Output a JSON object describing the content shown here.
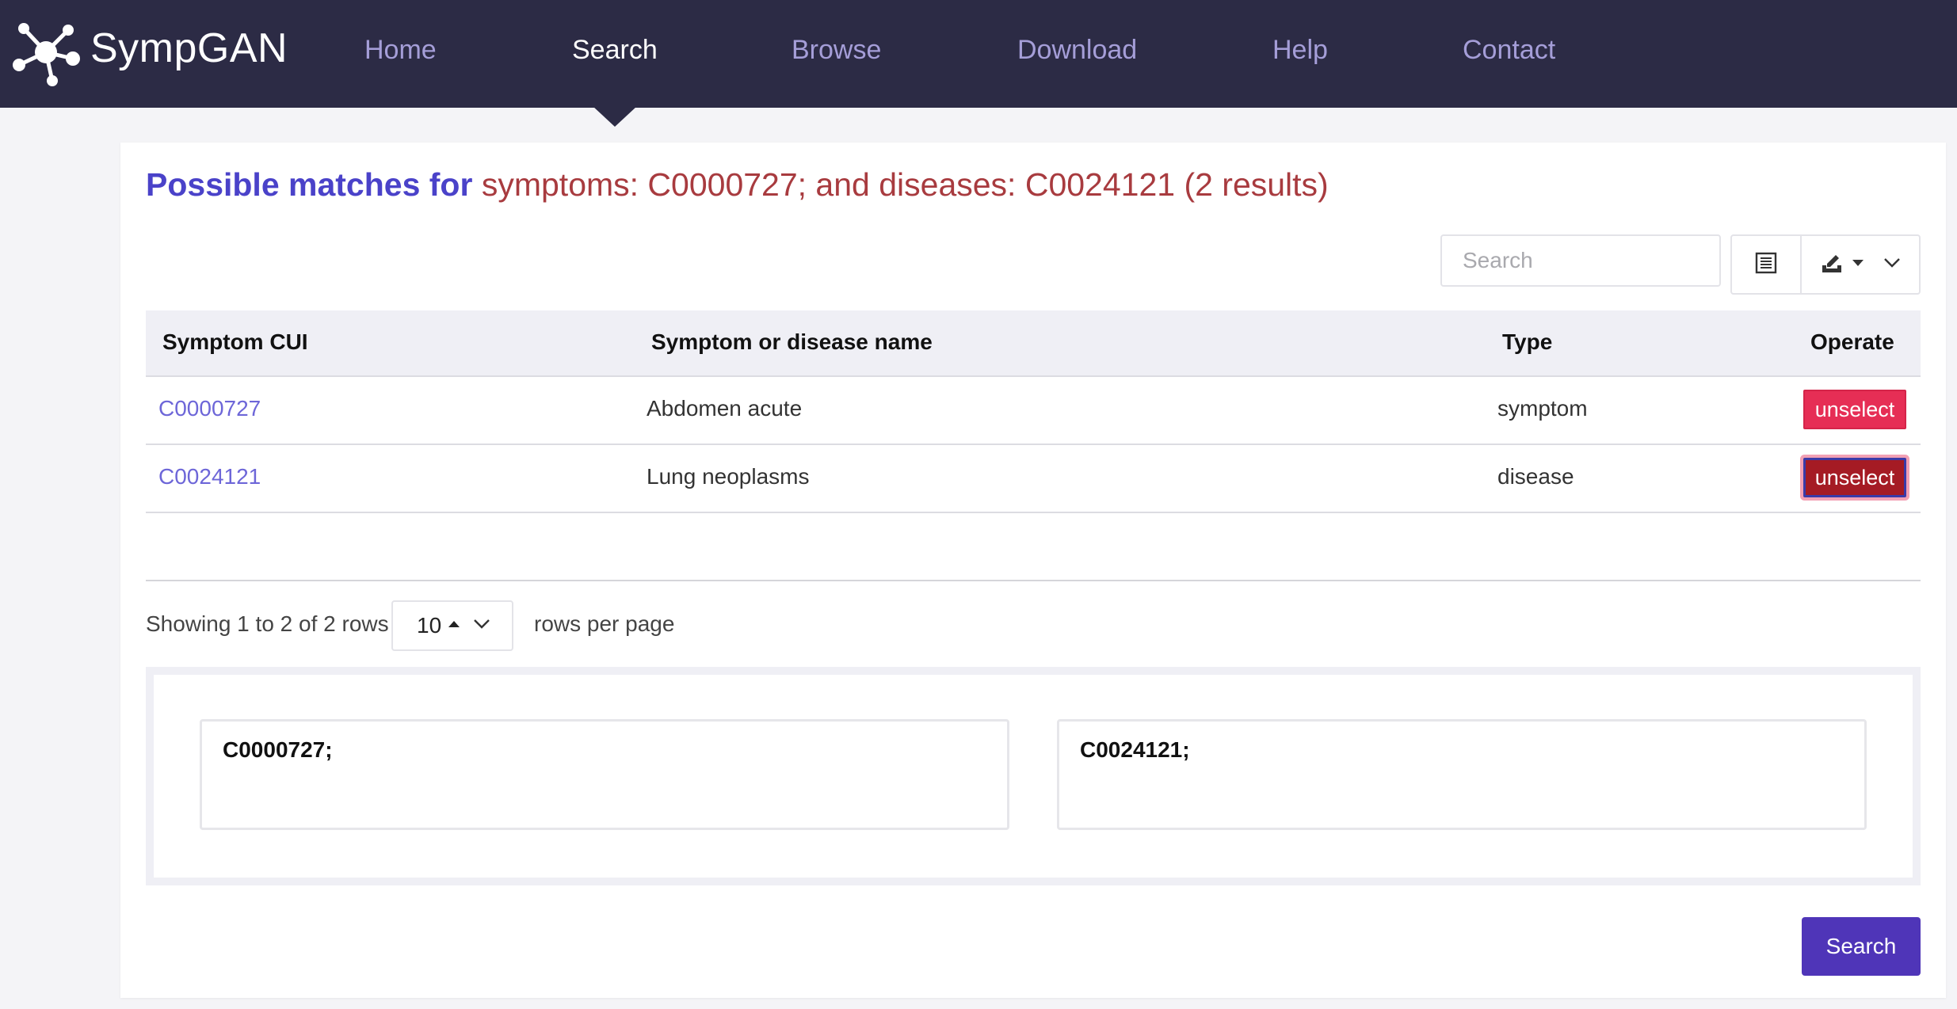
{
  "brand": {
    "name": "SympGAN",
    "logo_icon": "network-nodes-icon"
  },
  "nav": {
    "items": [
      "Home",
      "Search",
      "Browse",
      "Download",
      "Help",
      "Contact"
    ],
    "active": "Search"
  },
  "page": {
    "heading_lead": "Possible matches for",
    "heading_query": "symptoms: C0000727; and diseases: C0024121 (2 results)"
  },
  "toolbar": {
    "search_placeholder": "Search",
    "columns_icon": "list-columns-icon",
    "export_icon": "export-download-icon"
  },
  "table": {
    "headers": [
      "Symptom CUI",
      "Symptom or disease name",
      "Type",
      "Operate"
    ],
    "rows": [
      {
        "cui": "C0000727",
        "name": "Abdomen acute",
        "type": "symptom",
        "action": "unselect"
      },
      {
        "cui": "C0024121",
        "name": "Lung neoplasms",
        "type": "disease",
        "action": "unselect"
      }
    ]
  },
  "pagination": {
    "showing": "Showing 1 to 2 of 2 rows",
    "page_size": "10",
    "rows_per_page": "rows per page"
  },
  "selection": {
    "symptoms_value": "C0000727;",
    "diseases_value": "C0024121;"
  },
  "actions": {
    "search_label": "Search"
  },
  "colors": {
    "navbar": "#2c2b45",
    "heading_lead": "#4a42c9",
    "heading_query": "#a83b3f",
    "link": "#6d66d8",
    "unselect_pink": "#e62e55",
    "unselect_dark": "#a51b24",
    "search_button": "#4f35b8"
  }
}
